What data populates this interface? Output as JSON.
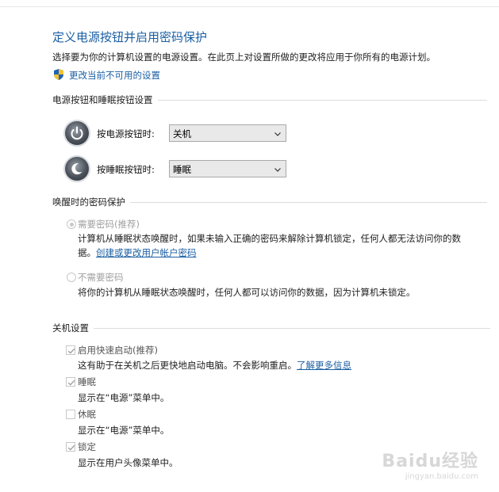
{
  "header": {
    "title": "定义电源按钮并启用密码保护",
    "subtitle": "选择要为你的计算机设置的电源设置。在此页上对设置所做的更改将应用于你所有的电源计划。",
    "change_link": "更改当前不可用的设置"
  },
  "power_section": {
    "heading": "电源按钮和睡眠按钮设置",
    "rows": [
      {
        "label": "按电源按钮时:",
        "value": "关机"
      },
      {
        "label": "按睡眠按钮时:",
        "value": "睡眠"
      }
    ]
  },
  "password_section": {
    "heading": "唤醒时的密码保护",
    "options": [
      {
        "label": "需要密码(推荐)",
        "selected": true,
        "desc_line1": "计算机从睡眠状态唤醒时，如果未输入正确的密码来解除计算机锁定，任何人都无法访问你的数",
        "desc_line2_prefix": "据。",
        "desc_link": "创建或更改用户帐户密码"
      },
      {
        "label": "不需要密码",
        "selected": false,
        "desc": "将你的计算机从睡眠状态唤醒时，任何人都可以访问你的数据，因为计算机未锁定。"
      }
    ]
  },
  "shutdown_section": {
    "heading": "关机设置",
    "items": [
      {
        "label": "启用快速启动(推荐)",
        "checked": true,
        "desc": "这有助于在关机之后更快地启动电脑。不会影响重启。",
        "link": "了解更多信息"
      },
      {
        "label": "睡眠",
        "checked": true,
        "desc": "显示在“电源”菜单中。"
      },
      {
        "label": "休眠",
        "checked": false,
        "desc": "显示在“电源”菜单中。"
      },
      {
        "label": "锁定",
        "checked": true,
        "desc": "显示在用户头像菜单中。"
      }
    ]
  },
  "watermark": {
    "logo": "Baidu经验",
    "url": "jingyan.baidu.com"
  },
  "colors": {
    "accent": "#1b5fa3",
    "disabled_text": "#a0a0a0"
  }
}
